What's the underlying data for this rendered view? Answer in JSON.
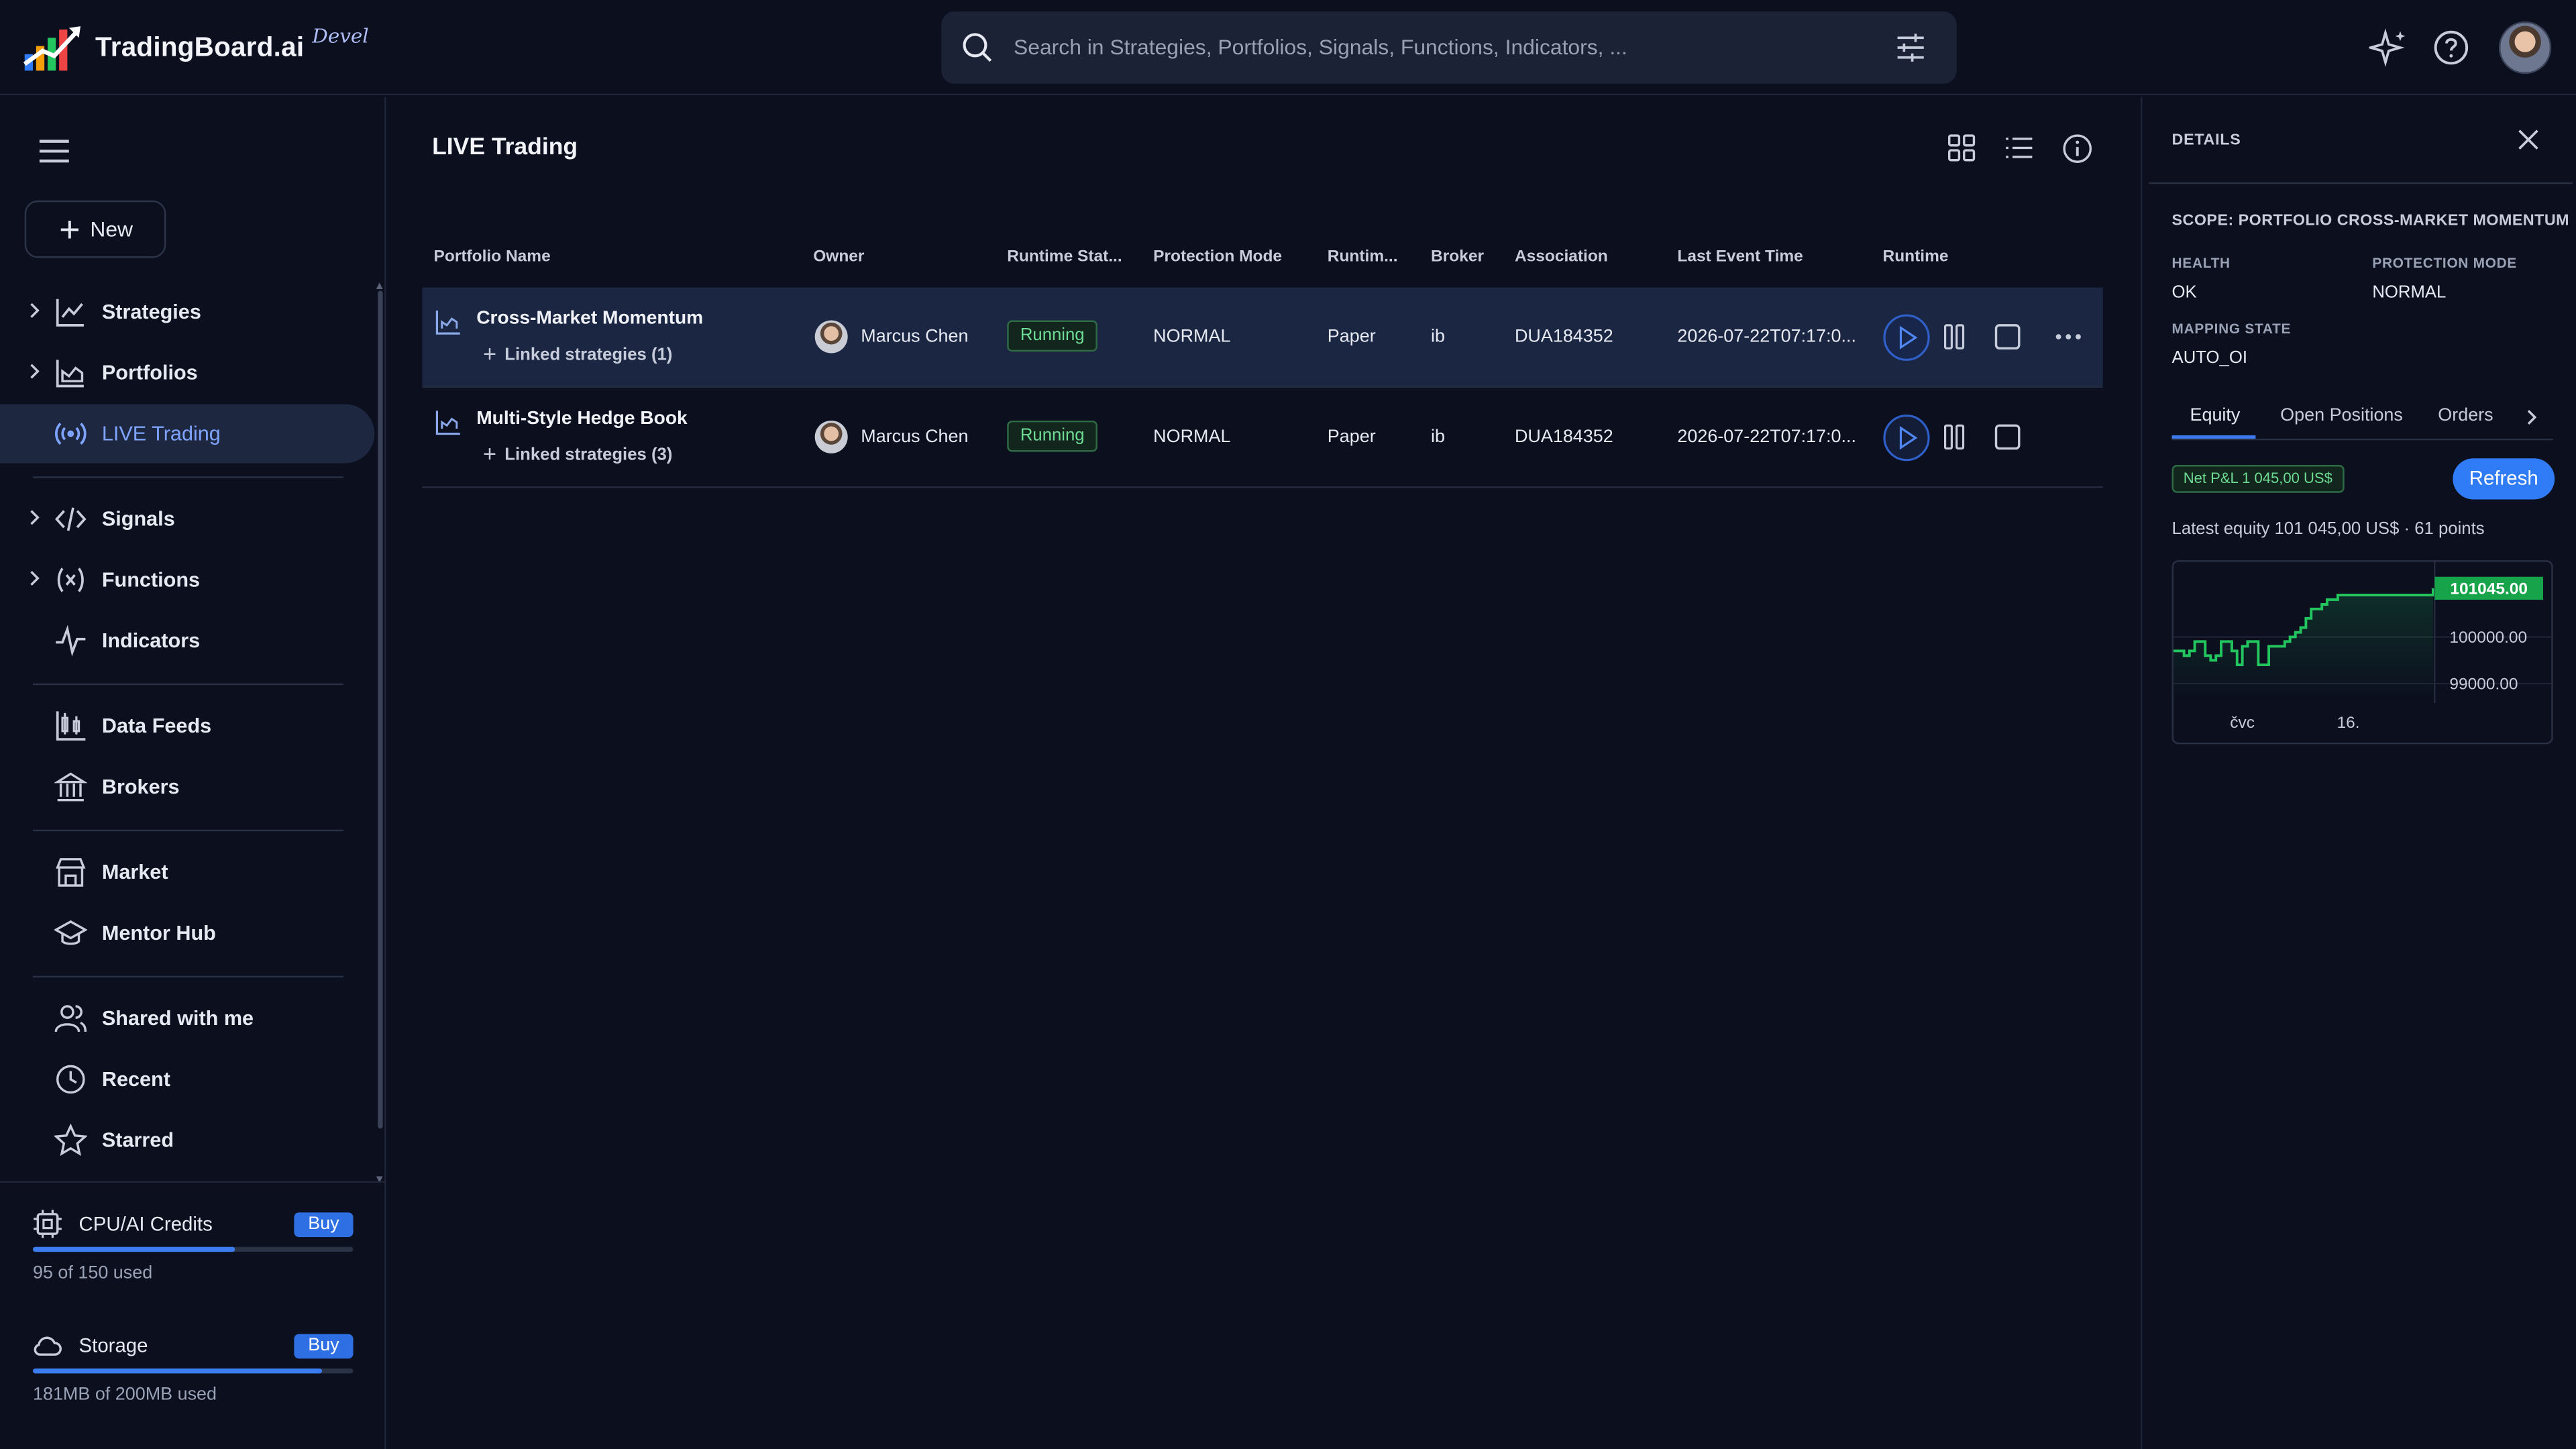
{
  "app": {
    "name": "TradingBoard.ai",
    "env_badge": "Devel"
  },
  "search": {
    "placeholder": "Search in Strategies, Portfolios, Signals, Functions, Indicators, ..."
  },
  "sidebar": {
    "new_label": "New",
    "items": [
      {
        "label": "Strategies",
        "icon": "chart-line-icon",
        "expandable": true
      },
      {
        "label": "Portfolios",
        "icon": "chart-area-icon",
        "expandable": true
      },
      {
        "label": "LIVE Trading",
        "icon": "broadcast-icon",
        "expandable": false,
        "active": true
      },
      {
        "label": "Signals",
        "icon": "code-icon",
        "expandable": true
      },
      {
        "label": "Functions",
        "icon": "function-icon",
        "expandable": true
      },
      {
        "label": "Indicators",
        "icon": "pulse-icon",
        "expandable": false
      },
      {
        "label": "Data Feeds",
        "icon": "candles-icon",
        "expandable": false
      },
      {
        "label": "Brokers",
        "icon": "bank-icon",
        "expandable": false
      },
      {
        "label": "Market",
        "icon": "store-icon",
        "expandable": false
      },
      {
        "label": "Mentor Hub",
        "icon": "graduation-cap-icon",
        "expandable": false
      },
      {
        "label": "Shared with me",
        "icon": "users-icon",
        "expandable": false
      },
      {
        "label": "Recent",
        "icon": "clock-icon",
        "expandable": false
      },
      {
        "label": "Starred",
        "icon": "star-icon",
        "expandable": false
      }
    ],
    "credits": {
      "label": "CPU/AI Credits",
      "buy": "Buy",
      "used_text": "95 of 150 used",
      "fraction": 0.633
    },
    "storage": {
      "label": "Storage",
      "buy": "Buy",
      "used_text": "181MB of 200MB used",
      "fraction": 0.905
    }
  },
  "main": {
    "title": "LIVE Trading",
    "columns": [
      "Portfolio Name",
      "Owner",
      "Runtime Stat...",
      "Protection Mode",
      "Runtim...",
      "Broker",
      "Association",
      "Last Event Time",
      "Runtime"
    ],
    "rows": [
      {
        "name": "Cross-Market Momentum",
        "linked": "Linked strategies (1)",
        "owner": "Marcus Chen",
        "status": "Running",
        "protection": "NORMAL",
        "runtime_mode": "Paper",
        "broker": "ib",
        "association": "DUA184352",
        "last_event": "2026-07-22T07:17:0...",
        "selected": true
      },
      {
        "name": "Multi-Style Hedge Book",
        "linked": "Linked strategies (3)",
        "owner": "Marcus Chen",
        "status": "Running",
        "protection": "NORMAL",
        "runtime_mode": "Paper",
        "broker": "ib",
        "association": "DUA184352",
        "last_event": "2026-07-22T07:17:0...",
        "selected": false
      }
    ]
  },
  "details": {
    "title": "DETAILS",
    "scope": "SCOPE: PORTFOLIO CROSS-MARKET MOMENTUM",
    "health_label": "HEALTH",
    "health": "OK",
    "protection_label": "PROTECTION MODE",
    "protection": "NORMAL",
    "mapping_label": "MAPPING STATE",
    "mapping": "AUTO_OI",
    "tabs": [
      "Equity",
      "Open Positions",
      "Orders"
    ],
    "pnl_badge": "Net P&L 1 045,00 US$",
    "refresh_label": "Refresh",
    "latest_text": "Latest equity 101 045,00 US$ · 61 points",
    "colors": {
      "accent": "#2f7cf6",
      "positive": "#22c55e"
    }
  },
  "chart_data": {
    "type": "line",
    "series": [
      {
        "values": [
          99700,
          99700,
          99600,
          99700,
          99900,
          99900,
          99600,
          99500,
          99600,
          99900,
          99900,
          99700,
          99400,
          99800,
          99900,
          99900,
          99400,
          99400,
          99800,
          99800,
          99800,
          99900,
          100000,
          100100,
          100200,
          100400,
          100600,
          100600,
          100700,
          100800,
          100800,
          100900,
          100900,
          100900,
          100900,
          100900,
          100900,
          100900,
          100900,
          100900,
          100900,
          100900,
          100900,
          100900,
          100900,
          100900,
          100900,
          100900,
          100900,
          101045
        ]
      }
    ],
    "last_value_label": "101045.00",
    "y_ticks": [
      "100000.00",
      "99000.00"
    ],
    "x_ticks": [
      "čvc",
      "16."
    ],
    "ylim": [
      98650,
      101400
    ]
  }
}
